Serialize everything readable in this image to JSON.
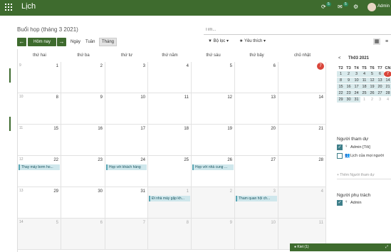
{
  "app": {
    "title": "Lịch"
  },
  "topbar": {
    "badge1": "5",
    "badge2": "5",
    "user": "Admin"
  },
  "page": {
    "breadcrumb": "Buổi họp (tháng 3 2021)"
  },
  "search": {
    "placeholder": "Tìm..."
  },
  "toolbar": {
    "today": "Hôm nay",
    "prev": "←",
    "next": "→",
    "views": [
      "Ngày",
      "Tuần",
      "Tháng"
    ],
    "active_view": "Tháng",
    "filter": "Bộ lọc",
    "favorites": "Yêu thích"
  },
  "calendar": {
    "day_headers": [
      "thứ hai",
      "thứ ba",
      "thứ tư",
      "thứ năm",
      "thứ sáu",
      "thứ bảy",
      "chủ nhật"
    ],
    "weeks": [
      {
        "week": "9",
        "days": [
          "1",
          "2",
          "3",
          "4",
          "5",
          "6",
          "7"
        ]
      },
      {
        "week": "10",
        "days": [
          "8",
          "9",
          "10",
          "11",
          "12",
          "13",
          "14"
        ]
      },
      {
        "week": "11",
        "days": [
          "15",
          "16",
          "17",
          "18",
          "19",
          "20",
          "21"
        ]
      },
      {
        "week": "12",
        "days": [
          "22",
          "23",
          "24",
          "25",
          "26",
          "27",
          "28"
        ]
      },
      {
        "week": "13",
        "days": [
          "29",
          "30",
          "31",
          "1",
          "2",
          "3",
          "4"
        ]
      },
      {
        "week": "14",
        "days": [
          "5",
          "6",
          "7",
          "8",
          "9",
          "10",
          "11"
        ]
      }
    ],
    "today": "7",
    "events": [
      {
        "label": "Thay máy bơm ho..."
      },
      {
        "label": "Họp với khách hàng"
      },
      {
        "label": "Họp với nhà cung ..."
      },
      {
        "label": "Đi nhà máy gặp kh..."
      },
      {
        "label": "Tham quan hội ch..."
      }
    ]
  },
  "mini_calendar": {
    "month": "Th03 2021",
    "prev": "<",
    "next": ">",
    "headers": [
      "T2",
      "T3",
      "T4",
      "T5",
      "T6",
      "T7",
      "CN"
    ],
    "rows": [
      [
        "1",
        "2",
        "3",
        "4",
        "5",
        "6",
        "7"
      ],
      [
        "8",
        "9",
        "10",
        "11",
        "12",
        "13",
        "14"
      ],
      [
        "15",
        "16",
        "17",
        "18",
        "19",
        "20",
        "21"
      ],
      [
        "22",
        "23",
        "24",
        "25",
        "26",
        "27",
        "28"
      ],
      [
        "29",
        "30",
        "31",
        "1",
        "2",
        "3",
        "4"
      ]
    ]
  },
  "attendees": {
    "title": "Người tham dự",
    "items": [
      "Admin [Tôi]",
      "Lịch của mọi người"
    ],
    "add_placeholder": "+ Thêm Người tham dự"
  },
  "responsible": {
    "title": "Người phụ trách",
    "items": [
      "Admin"
    ]
  },
  "chat": {
    "label": "Kiet (1)"
  },
  "colors": {
    "brand": "#3e6b2e",
    "event_fill": "#cfe7ec",
    "event_border": "#5aa6b4",
    "today": "#d9453a"
  }
}
